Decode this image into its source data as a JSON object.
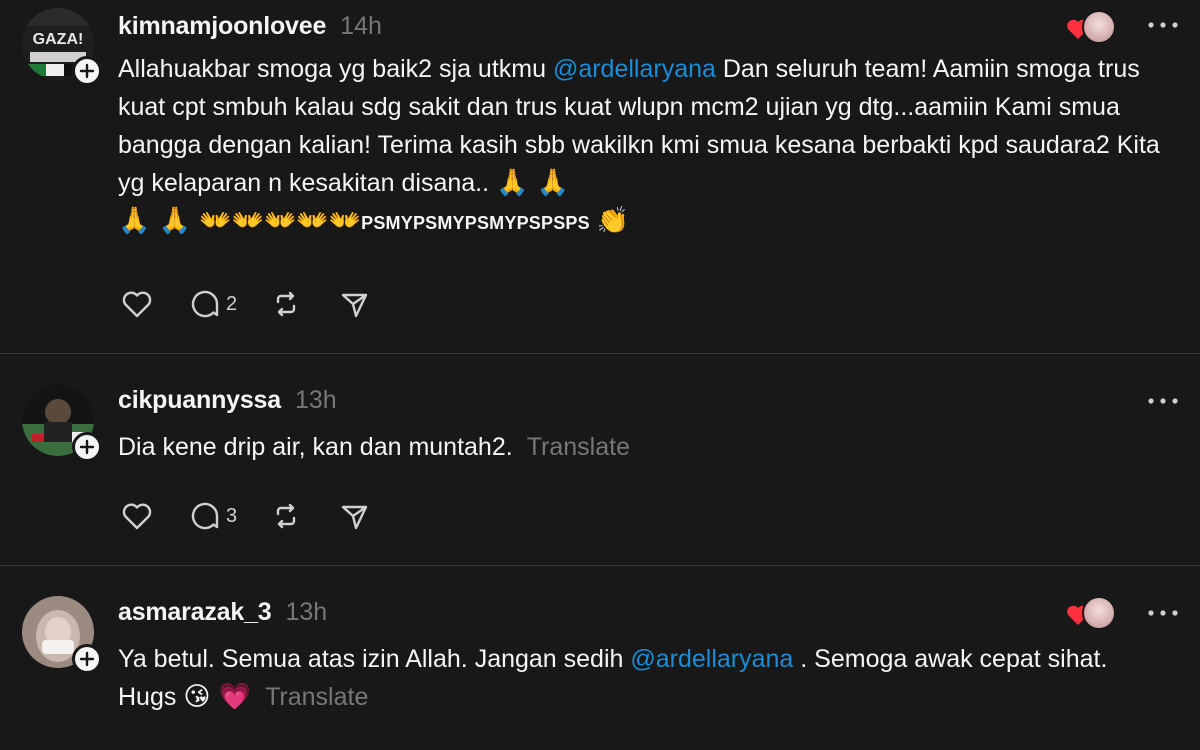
{
  "posts": [
    {
      "username": "kimnamjoonlovee",
      "time": "14h",
      "text_segments": [
        {
          "text": "Allahuakbar smoga yg baik2 sja utkmu "
        },
        {
          "text": "@ardellaryana",
          "mention": true
        },
        {
          "text": " Dan seluruh team! Aamiin smoga trus kuat cpt smbuh kalau sdg sakit dan trus kuat wlupn mcm2 ujian yg dtg...aamiin Kami smua bangga dengan kalian! Terima kasih sbb wakilkn kmi smua kesana berbakti kpd saudara2 Kita yg kelaparan n kesakitan disana.. "
        }
      ],
      "emojis_1": "🙏 🙏",
      "emojis_2": "🙏 🙏 👐👐👐👐👐",
      "caps_tail": "PSMYPSMYPSMYPSPSPS",
      "emoji_end": "👏",
      "liked_by_author": true,
      "reply_count": "2",
      "avatar_label": "GAZA!"
    },
    {
      "username": "cikpuannyssa",
      "time": "13h",
      "text": "Dia kene drip air, kan dan muntah2.",
      "translate": "Translate",
      "liked_by_author": false,
      "reply_count": "3"
    },
    {
      "username": "asmarazak_3",
      "time": "13h",
      "text_before": "Ya betul. Semua atas izin Allah. Jangan sedih ",
      "mention": "@ardellaryana",
      "text_after": " . Semoga awak cepat sihat. Hugs ",
      "emojis": "😘 💗",
      "translate": "Translate",
      "liked_by_author": true
    }
  ],
  "icons": {
    "like": "heart-outline-icon",
    "reply": "speech-bubble-icon",
    "repost": "repost-arrows-icon",
    "share": "paper-plane-icon",
    "more": "ellipsis-icon",
    "follow": "plus-icon"
  },
  "colors": {
    "background": "#181818",
    "text": "#f3f5f7",
    "muted": "#777777",
    "mention": "#1a8cd8",
    "heart": "#ff3040"
  }
}
